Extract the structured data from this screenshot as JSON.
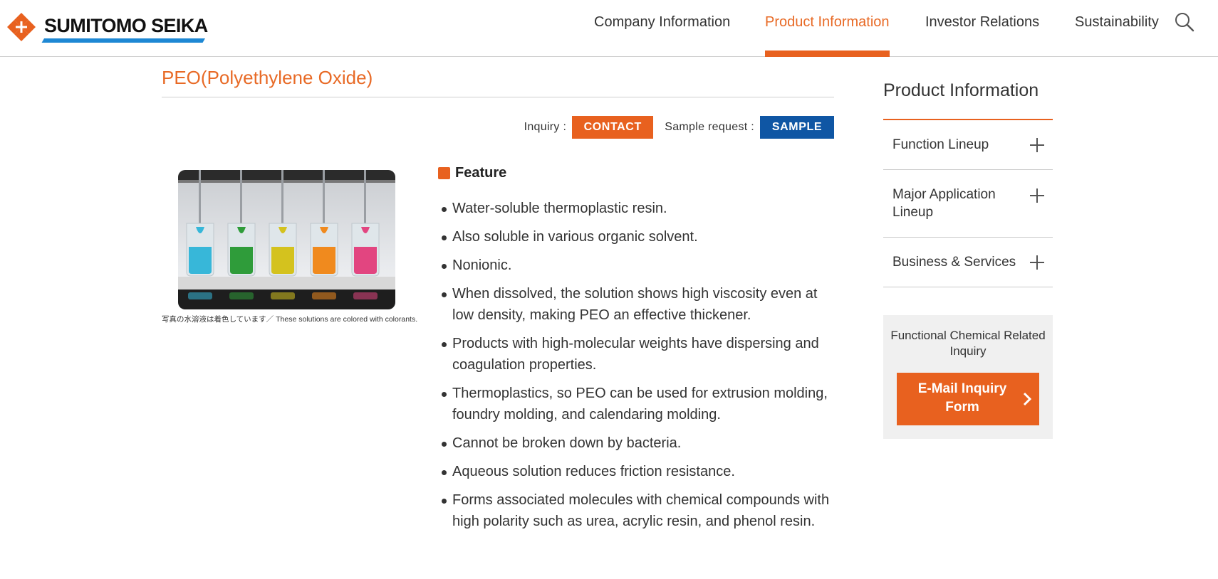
{
  "header": {
    "logo_text": "SUMITOMO SEIKA",
    "nav": [
      {
        "label": "Company Information",
        "active": false
      },
      {
        "label": "Product Information",
        "active": true
      },
      {
        "label": "Investor Relations",
        "active": false
      },
      {
        "label": "Sustainability",
        "active": false
      }
    ],
    "search_icon": "magnifier-icon"
  },
  "main": {
    "title": "PEO(Polyethylene Oxide)",
    "inquiry_label": "Inquiry :",
    "contact_label": "CONTACT",
    "sample_label": "Sample request :",
    "sample_button_label": "SAMPLE",
    "photo_caption": "写真の水溶液は着色しています／ These solutions are colored with colorants.",
    "feature_title": "Feature",
    "features": [
      "Water-soluble thermoplastic resin.",
      "Also soluble in various organic solvent.",
      "Nonionic.",
      "When dissolved, the solution shows high viscosity even at low density, making PEO an effective thickener.",
      "Products with high-molecular weights have dispersing and coagulation properties.",
      "Thermoplastics, so PEO can be used for extrusion molding, foundry molding, and calendaring molding.",
      "Cannot be broken down by bacteria.",
      "Aqueous solution reduces friction resistance.",
      "Forms associated molecules with chemical compounds with high polarity such as urea, acrylic resin, and phenol resin."
    ]
  },
  "sidebar": {
    "title": "Product Information",
    "items": [
      {
        "label": "Function Lineup"
      },
      {
        "label": "Major Application Lineup"
      },
      {
        "label": "Business & Services"
      }
    ],
    "inquiry_box_text": "Functional Chemical Related Inquiry",
    "email_button_label": "E-Mail Inquiry Form"
  },
  "colors": {
    "accent_orange": "#e8611f",
    "sample_blue": "#0f56a4",
    "logo_blue": "#1e88d4"
  }
}
